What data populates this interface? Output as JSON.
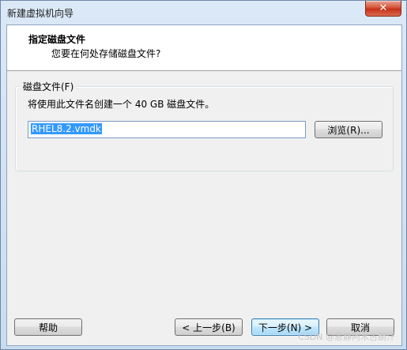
{
  "window": {
    "title": "新建虚拟机向导",
    "close_symbol": "✕"
  },
  "header": {
    "title": "指定磁盘文件",
    "subtitle": "您要在何处存储磁盘文件?"
  },
  "disk_file": {
    "group_label": "磁盘文件(F)",
    "description": "将使用此文件名创建一个 40 GB 磁盘文件。",
    "value": "RHEL8.2.vmdk",
    "browse_label": "浏览(R)..."
  },
  "footer": {
    "help_label": "帮助",
    "back_label": "< 上一步(B)",
    "next_label": "下一步(N) >",
    "cancel_label": "取消"
  },
  "watermark": "CSDN @恩静阿木古朗汗",
  "colors": {
    "accent": "#3399ff",
    "close": "#c53218"
  }
}
